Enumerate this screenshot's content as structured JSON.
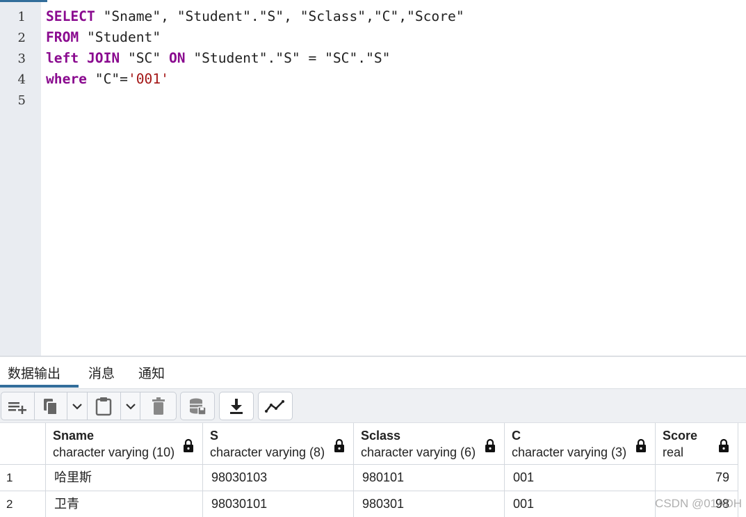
{
  "editor": {
    "line_numbers": [
      "1",
      "2",
      "3",
      "4",
      "5"
    ],
    "lines": [
      [
        {
          "t": "SELECT",
          "c": "kw"
        },
        {
          "t": " \"Sname\", \"Student\".\"S\", \"Sclass\",\"C\",\"Score\"",
          "c": ""
        }
      ],
      [
        {
          "t": "FROM",
          "c": "kw"
        },
        {
          "t": " \"Student\"",
          "c": ""
        }
      ],
      [
        {
          "t": "left JOIN",
          "c": "kw"
        },
        {
          "t": " \"SC\" ",
          "c": ""
        },
        {
          "t": "ON",
          "c": "kw"
        },
        {
          "t": " \"Student\".\"S\" = \"SC\".\"S\"",
          "c": ""
        }
      ],
      [
        {
          "t": "where",
          "c": "kw"
        },
        {
          "t": " \"C\"=",
          "c": ""
        },
        {
          "t": "'001'",
          "c": "str"
        }
      ],
      []
    ]
  },
  "tabs": [
    "数据输出",
    "消息",
    "通知"
  ],
  "toolbar": {
    "icons": [
      "add-row-icon",
      "copy-icon",
      "chevron-down-icon",
      "paste-icon",
      "chevron-down-icon",
      "delete-icon",
      "save-data-icon",
      "download-icon",
      "graph-icon"
    ]
  },
  "grid": {
    "columns": [
      {
        "name": "Sname",
        "type": "character varying (10)"
      },
      {
        "name": "S",
        "type": "character varying (8)"
      },
      {
        "name": "Sclass",
        "type": "character varying (6)"
      },
      {
        "name": "C",
        "type": "character varying (3)"
      },
      {
        "name": "Score",
        "type": "real"
      }
    ],
    "rows": [
      {
        "num": "1",
        "cells": [
          "哈里斯",
          "98030103",
          "980101",
          "001",
          "79"
        ]
      },
      {
        "num": "2",
        "cells": [
          "卫青",
          "98030101",
          "980301",
          "001",
          "98"
        ]
      }
    ]
  },
  "watermark": "CSDN @01ADH",
  "colors": {
    "keyword": "#8a0a8f",
    "string": "#a31515",
    "accent": "#336e9b"
  }
}
